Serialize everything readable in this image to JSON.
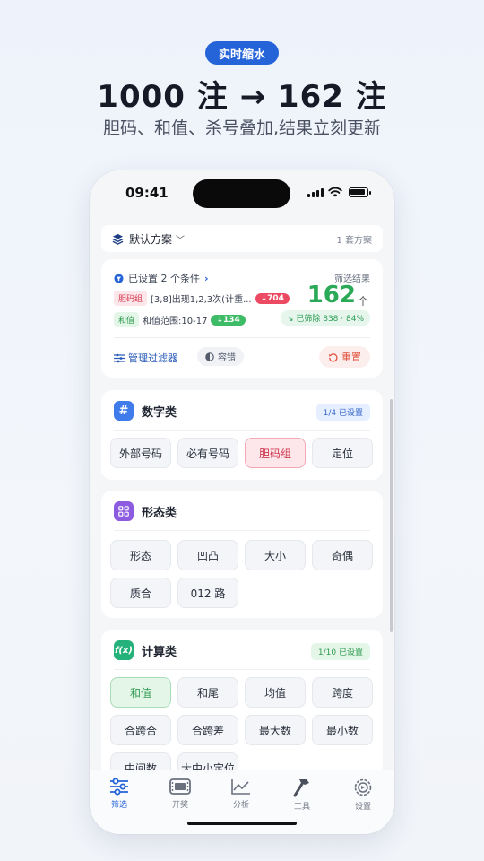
{
  "promo": {
    "pill": "实时缩水",
    "title": "1000 注 → 162 注",
    "subtitle": "胆码、和值、杀号叠加,结果立刻更新"
  },
  "status": {
    "time": "09:41"
  },
  "plan": {
    "name": "默认方案",
    "count": "1 套方案"
  },
  "summary": {
    "conditions": "已设置 2 个条件",
    "rows": [
      {
        "tag": "胆码组",
        "text": "[3,8]出现1,2,3次(计重...",
        "delta": "↓704"
      },
      {
        "tag": "和值",
        "text": "和值范围:10-17",
        "delta": "↓134"
      }
    ],
    "result_label": "筛选结果",
    "result_value": "162",
    "result_unit": "个",
    "removed": "↘ 已筛除 838 · 84%",
    "manage": "管理过滤器",
    "tolerance": "容错",
    "reset": "重置"
  },
  "categories": {
    "digit": {
      "title": "数字类",
      "badge": "1/4 已设置",
      "chips": [
        "外部号码",
        "必有号码",
        "胆码组",
        "定位"
      ]
    },
    "shape": {
      "title": "形态类",
      "chips": [
        "形态",
        "凹凸",
        "大小",
        "奇偶",
        "质合",
        "012 路"
      ]
    },
    "calc": {
      "title": "计算类",
      "badge": "1/10 已设置",
      "chips": [
        "和值",
        "和尾",
        "均值",
        "跨度",
        "合跨合",
        "合跨差",
        "最大数",
        "最小数",
        "中间数",
        "大中小定位"
      ]
    }
  },
  "tabs": [
    "筛选",
    "开奖",
    "分析",
    "工具",
    "设置"
  ],
  "colors": {
    "accent": "#2563d9",
    "success": "#2aa957",
    "danger": "#ec4a63"
  }
}
